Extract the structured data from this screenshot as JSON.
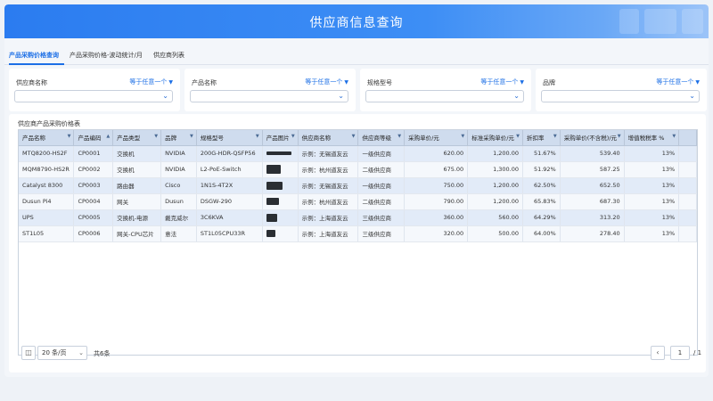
{
  "header": {
    "title": "供应商信息查询"
  },
  "tabs": [
    {
      "label": "产品采购价格查询",
      "active": true
    },
    {
      "label": "产品采购价格-波动统计/月",
      "active": false
    },
    {
      "label": "供应商列表",
      "active": false
    }
  ],
  "filters": [
    {
      "label": "供应商名称",
      "operator": "等于任意一个"
    },
    {
      "label": "产品名称",
      "operator": "等于任意一个"
    },
    {
      "label": "规格型号",
      "operator": "等于任意一个"
    },
    {
      "label": "品牌",
      "operator": "等于任意一个"
    }
  ],
  "table": {
    "title": "供应商产品采购价格表",
    "columns": [
      "产品名称",
      "产品编码",
      "产品类型",
      "品牌",
      "规格型号",
      "产品图片",
      "供应商名称",
      "供应商等级",
      "采购单价/元",
      "标准采购单价/元",
      "折扣率",
      "采购单价(不含税)/元",
      "增值税税率 %"
    ],
    "rows": [
      [
        "MTQ8200-HS2F",
        "CP0001",
        "交换机",
        "NVIDIA",
        "200G-HDR-QSFP56",
        "",
        "示例：无锡道友云",
        "一级供应商",
        "620.00",
        "1,200.00",
        "51.67%",
        "539.40",
        "13%"
      ],
      [
        "MQM8790-HS2R",
        "CP0002",
        "交换机",
        "NVIDIA",
        "L2-PoE-Switch",
        "",
        "示例：杭州道友云",
        "二级供应商",
        "675.00",
        "1,300.00",
        "51.92%",
        "587.25",
        "13%"
      ],
      [
        "Catalyst 8300",
        "CP0003",
        "路由器",
        "Cisco",
        "1N1S-4T2X",
        "",
        "示例：无锡道友云",
        "一级供应商",
        "750.00",
        "1,200.00",
        "62.50%",
        "652.50",
        "13%"
      ],
      [
        "Dusun Pi4",
        "CP0004",
        "网关",
        "Dusun",
        "DSGW-290",
        "",
        "示例：杭州道友云",
        "二级供应商",
        "790.00",
        "1,200.00",
        "65.83%",
        "687.30",
        "13%"
      ],
      [
        "UPS",
        "CP0005",
        "交换机-电源",
        "戴克威尔",
        "3C6KVA",
        "",
        "示例：上海道友云",
        "三级供应商",
        "360.00",
        "560.00",
        "64.29%",
        "313.20",
        "13%"
      ],
      [
        "ST1L05",
        "CP0006",
        "网关-CPU芯片",
        "意法",
        "ST1L05CPU33R",
        "",
        "示例：上海道友云",
        "三级供应商",
        "320.00",
        "500.00",
        "64.00%",
        "278.40",
        "13%"
      ]
    ]
  },
  "pager": {
    "page_size": "20 条/页",
    "total": "共6条",
    "current_page": "1",
    "of_pages": "/ 1"
  },
  "colors": {
    "accent": "#1c6fe6",
    "header": "#2b7cf0"
  }
}
